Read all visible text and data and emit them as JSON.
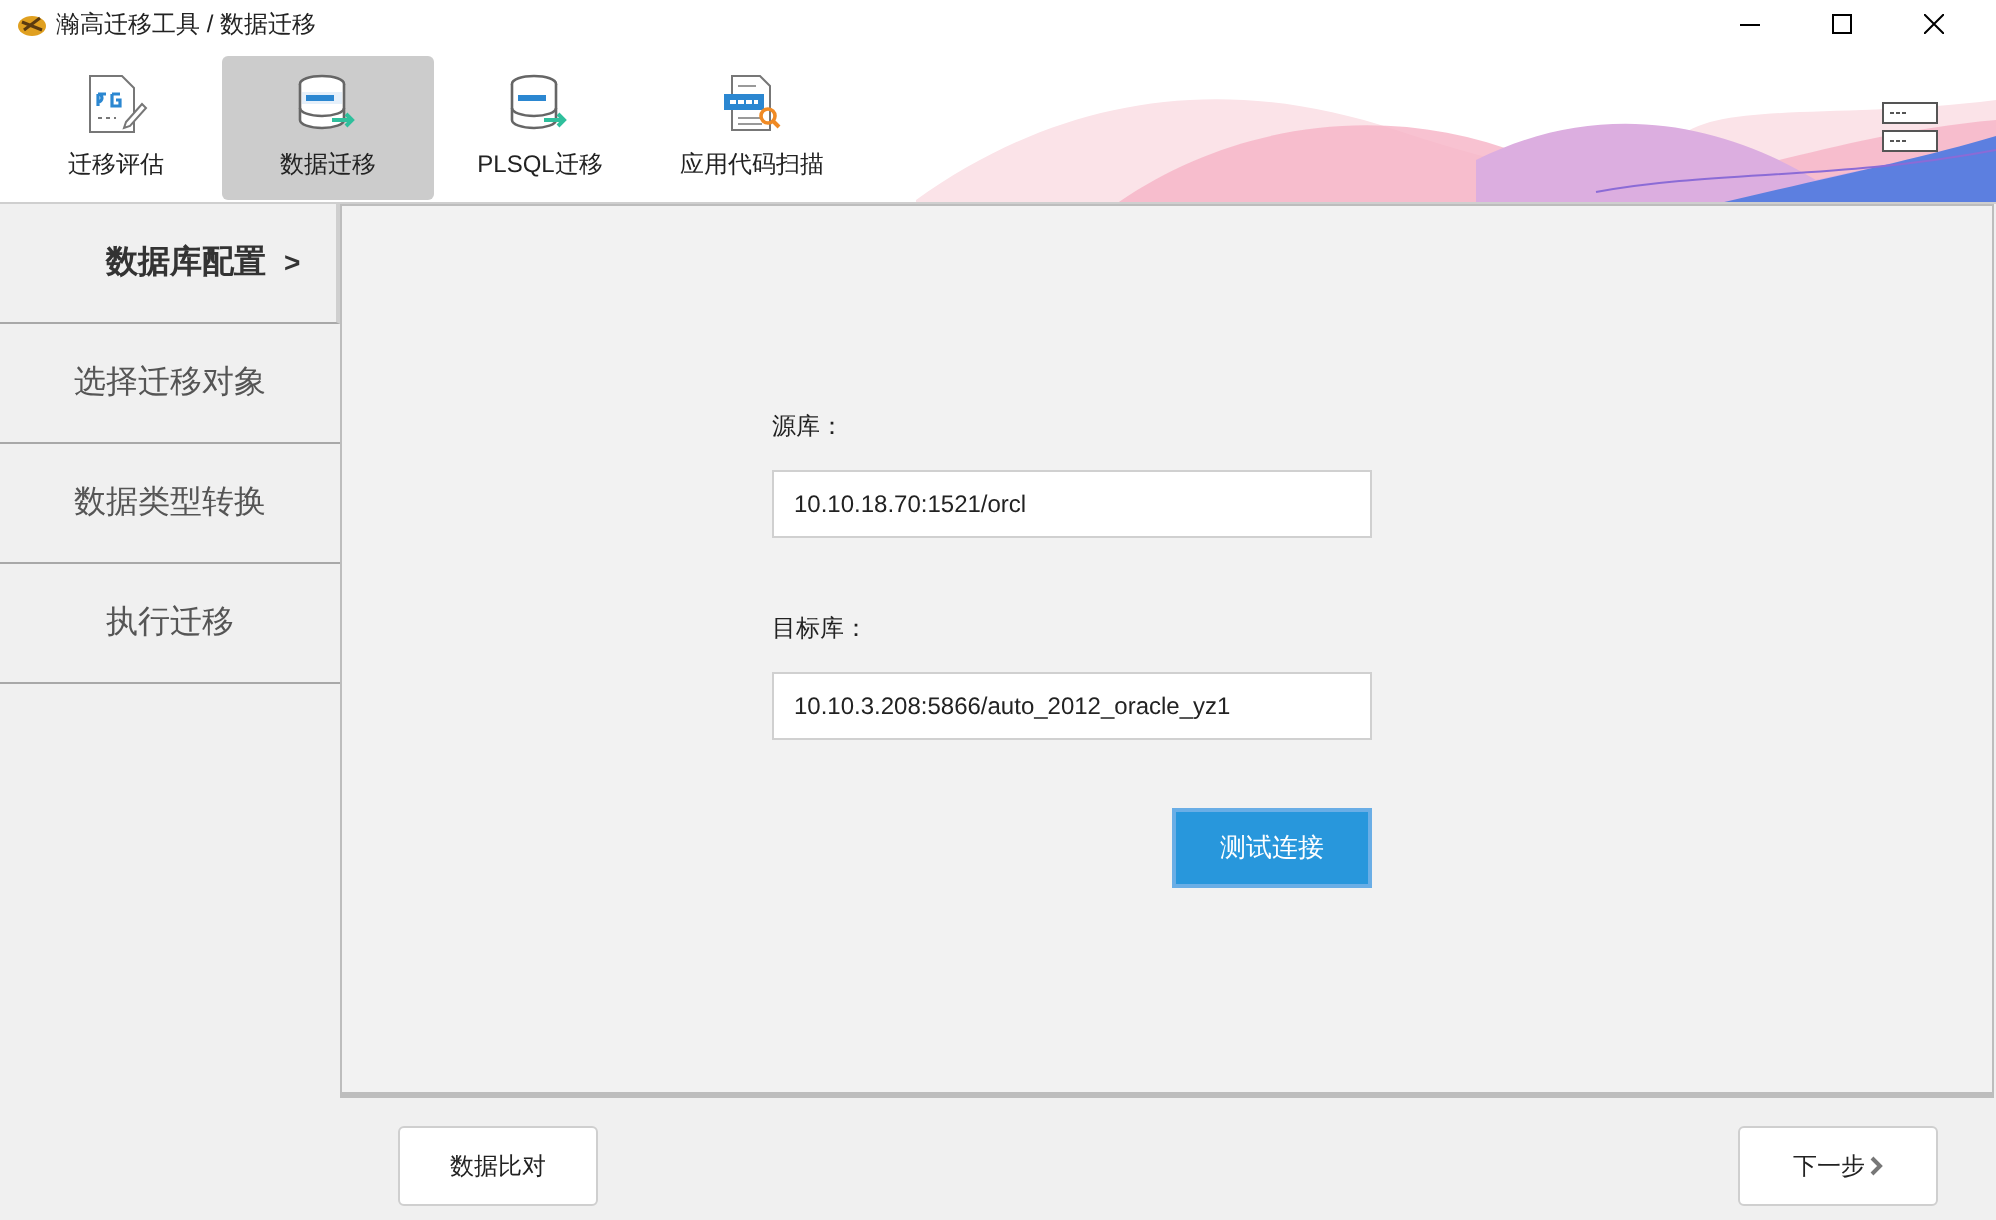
{
  "window": {
    "title": "瀚高迁移工具 / 数据迁移"
  },
  "toolbar": {
    "items": [
      {
        "label": "迁移评估",
        "kind": "assessment",
        "selected": false
      },
      {
        "label": "数据迁移",
        "kind": "data",
        "selected": true
      },
      {
        "label": "PLSQL迁移",
        "kind": "plsql",
        "selected": false
      },
      {
        "label": "应用代码扫描",
        "kind": "scan",
        "selected": false
      }
    ]
  },
  "sidebar": {
    "marker": ">",
    "items": [
      {
        "label": "数据库配置",
        "selected": true
      },
      {
        "label": "选择迁移对象",
        "selected": false
      },
      {
        "label": "数据类型转换",
        "selected": false
      },
      {
        "label": "执行迁移",
        "selected": false
      }
    ]
  },
  "form": {
    "fields": [
      {
        "label": "源库：",
        "value": "10.10.18.70:1521/orcl"
      },
      {
        "label": "目标库：",
        "value": "10.10.3.208:5866/auto_2012_oracle_yz1"
      }
    ],
    "test_button": "测试连接"
  },
  "footer": {
    "compare_button": "数据比对",
    "next_button": "下一步"
  }
}
